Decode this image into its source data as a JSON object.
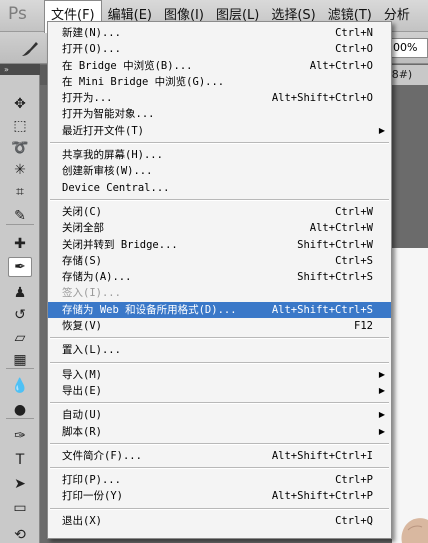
{
  "app": {
    "logo": "Ps"
  },
  "menubar": [
    {
      "label": "文件(F)",
      "name": "file",
      "active": true
    },
    {
      "label": "编辑(E)",
      "name": "edit"
    },
    {
      "label": "图像(I)",
      "name": "image"
    },
    {
      "label": "图层(L)",
      "name": "layer"
    },
    {
      "label": "选择(S)",
      "name": "select"
    },
    {
      "label": "滤镜(T)",
      "name": "filter"
    },
    {
      "label": "分析",
      "name": "analysis"
    }
  ],
  "options": {
    "zoom": "00%"
  },
  "doc_tab": {
    "label": "/8#)"
  },
  "toolbox": {
    "header": "»"
  },
  "file_menu": [
    {
      "label": "新建(N)...",
      "shortcut": "Ctrl+N"
    },
    {
      "label": "打开(O)...",
      "shortcut": "Ctrl+O"
    },
    {
      "label": "在 Bridge 中浏览(B)...",
      "shortcut": "Alt+Ctrl+O"
    },
    {
      "label": "在 Mini Bridge 中浏览(G)...",
      "shortcut": ""
    },
    {
      "label": "打开为...",
      "shortcut": "Alt+Shift+Ctrl+O"
    },
    {
      "label": "打开为智能对象...",
      "shortcut": ""
    },
    {
      "label": "最近打开文件(T)",
      "shortcut": "",
      "submenu": true
    },
    {
      "separator": true
    },
    {
      "label": "共享我的屏幕(H)...",
      "shortcut": ""
    },
    {
      "label": "创建新审核(W)...",
      "shortcut": ""
    },
    {
      "label": "Device Central...",
      "shortcut": ""
    },
    {
      "separator": true
    },
    {
      "label": "关闭(C)",
      "shortcut": "Ctrl+W"
    },
    {
      "label": "关闭全部",
      "shortcut": "Alt+Ctrl+W"
    },
    {
      "label": "关闭并转到 Bridge...",
      "shortcut": "Shift+Ctrl+W"
    },
    {
      "label": "存储(S)",
      "shortcut": "Ctrl+S"
    },
    {
      "label": "存储为(A)...",
      "shortcut": "Shift+Ctrl+S"
    },
    {
      "label": "签入(I)...",
      "shortcut": "",
      "disabled": true
    },
    {
      "label": "存储为 Web 和设备所用格式(D)...",
      "shortcut": "Alt+Shift+Ctrl+S",
      "highlight": true
    },
    {
      "label": "恢复(V)",
      "shortcut": "F12"
    },
    {
      "separator": true
    },
    {
      "label": "置入(L)...",
      "shortcut": ""
    },
    {
      "separator": true
    },
    {
      "label": "导入(M)",
      "shortcut": "",
      "submenu": true
    },
    {
      "label": "导出(E)",
      "shortcut": "",
      "submenu": true
    },
    {
      "separator": true
    },
    {
      "label": "自动(U)",
      "shortcut": "",
      "submenu": true
    },
    {
      "label": "脚本(R)",
      "shortcut": "",
      "submenu": true
    },
    {
      "separator": true
    },
    {
      "label": "文件简介(F)...",
      "shortcut": "Alt+Shift+Ctrl+I"
    },
    {
      "separator": true
    },
    {
      "label": "打印(P)...",
      "shortcut": "Ctrl+P"
    },
    {
      "label": "打印一份(Y)",
      "shortcut": "Alt+Shift+Ctrl+P"
    },
    {
      "separator": true
    },
    {
      "label": "退出(X)",
      "shortcut": "Ctrl+Q"
    }
  ],
  "tools": [
    {
      "name": "move-tool-icon",
      "glyph": "✥"
    },
    {
      "name": "marquee-tool-icon",
      "glyph": "⬚"
    },
    {
      "name": "lasso-tool-icon",
      "glyph": "➰"
    },
    {
      "name": "magic-wand-tool-icon",
      "glyph": "✳"
    },
    {
      "name": "crop-tool-icon",
      "glyph": "⌗"
    },
    {
      "name": "eyedropper-tool-icon",
      "glyph": "✎"
    },
    {
      "name": "healing-brush-tool-icon",
      "glyph": "✚"
    },
    {
      "name": "brush-tool-icon",
      "glyph": "✒",
      "selected": true
    },
    {
      "name": "clone-stamp-tool-icon",
      "glyph": "♟"
    },
    {
      "name": "history-brush-tool-icon",
      "glyph": "↺"
    },
    {
      "name": "eraser-tool-icon",
      "glyph": "▱"
    },
    {
      "name": "gradient-tool-icon",
      "glyph": "▦"
    },
    {
      "name": "blur-tool-icon",
      "glyph": "💧"
    },
    {
      "name": "dodge-tool-icon",
      "glyph": "●"
    },
    {
      "name": "pen-tool-icon",
      "glyph": "✑"
    },
    {
      "name": "type-tool-icon",
      "glyph": "T"
    },
    {
      "name": "path-selection-tool-icon",
      "glyph": "➤"
    },
    {
      "name": "shape-tool-icon",
      "glyph": "▭"
    },
    {
      "name": "3d-rotate-tool-icon",
      "glyph": "⟲"
    }
  ]
}
